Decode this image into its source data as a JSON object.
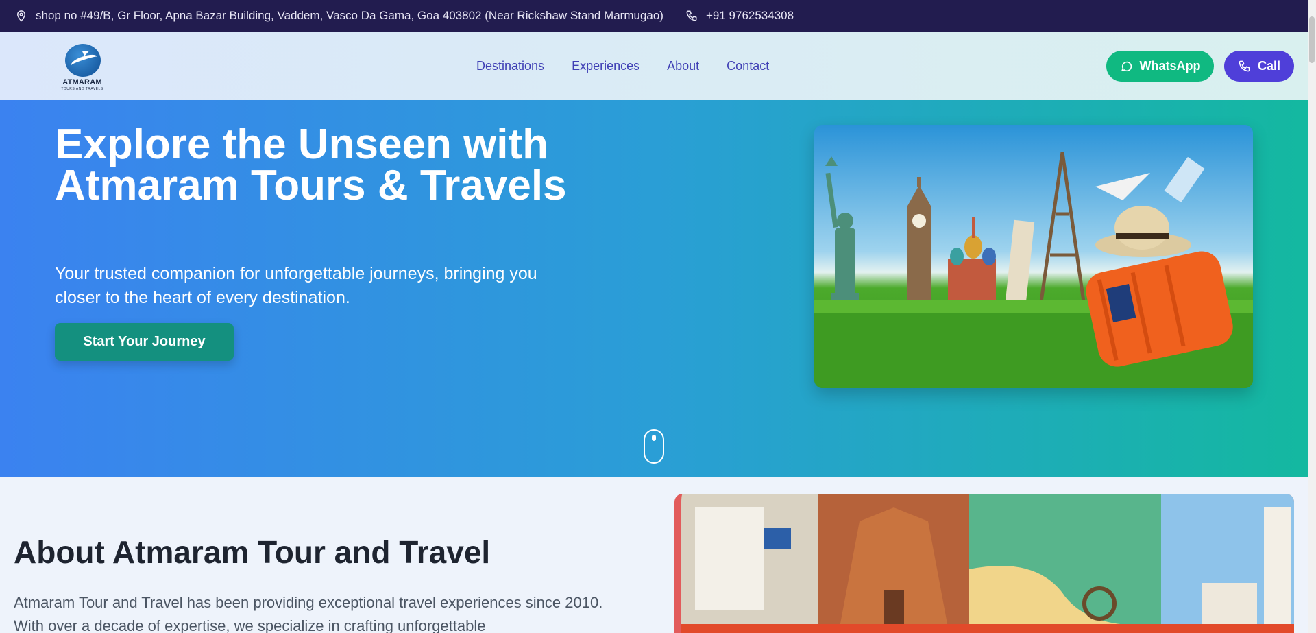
{
  "topbar": {
    "address": "shop no #49/B, Gr Floor, Apna Bazar Building, Vaddem, Vasco Da Gama, Goa 403802 (Near Rickshaw Stand Marmugao)",
    "phone": "+91 9762534308",
    "icons": [
      "location-pin-icon",
      "phone-icon"
    ]
  },
  "header": {
    "logo": {
      "brand": "ATMARAM",
      "tagline": "TOURS AND TRAVELS"
    },
    "nav": [
      {
        "label": "Destinations"
      },
      {
        "label": "Experiences"
      },
      {
        "label": "About"
      },
      {
        "label": "Contact"
      }
    ],
    "whatsapp_label": "WhatsApp",
    "call_label": "Call"
  },
  "hero": {
    "title": "Explore the Unseen with Atmaram Tours & Travels",
    "subtitle": "Your trusted companion for unforgettable journeys, bringing you closer to the heart of every destination.",
    "cta_label": "Start Your Journey"
  },
  "about": {
    "title": "About Atmaram Tour and Travel",
    "text": "Atmaram Tour and Travel has been providing exceptional travel experiences since 2010. With over a decade of expertise, we specialize in crafting unforgettable"
  },
  "colors": {
    "topbar_bg": "#221c4f",
    "nav_text": "#3f3fb5",
    "whatsapp_green": "#10b981",
    "call_purple": "#4f3fd9",
    "cta_teal": "#14907f"
  }
}
